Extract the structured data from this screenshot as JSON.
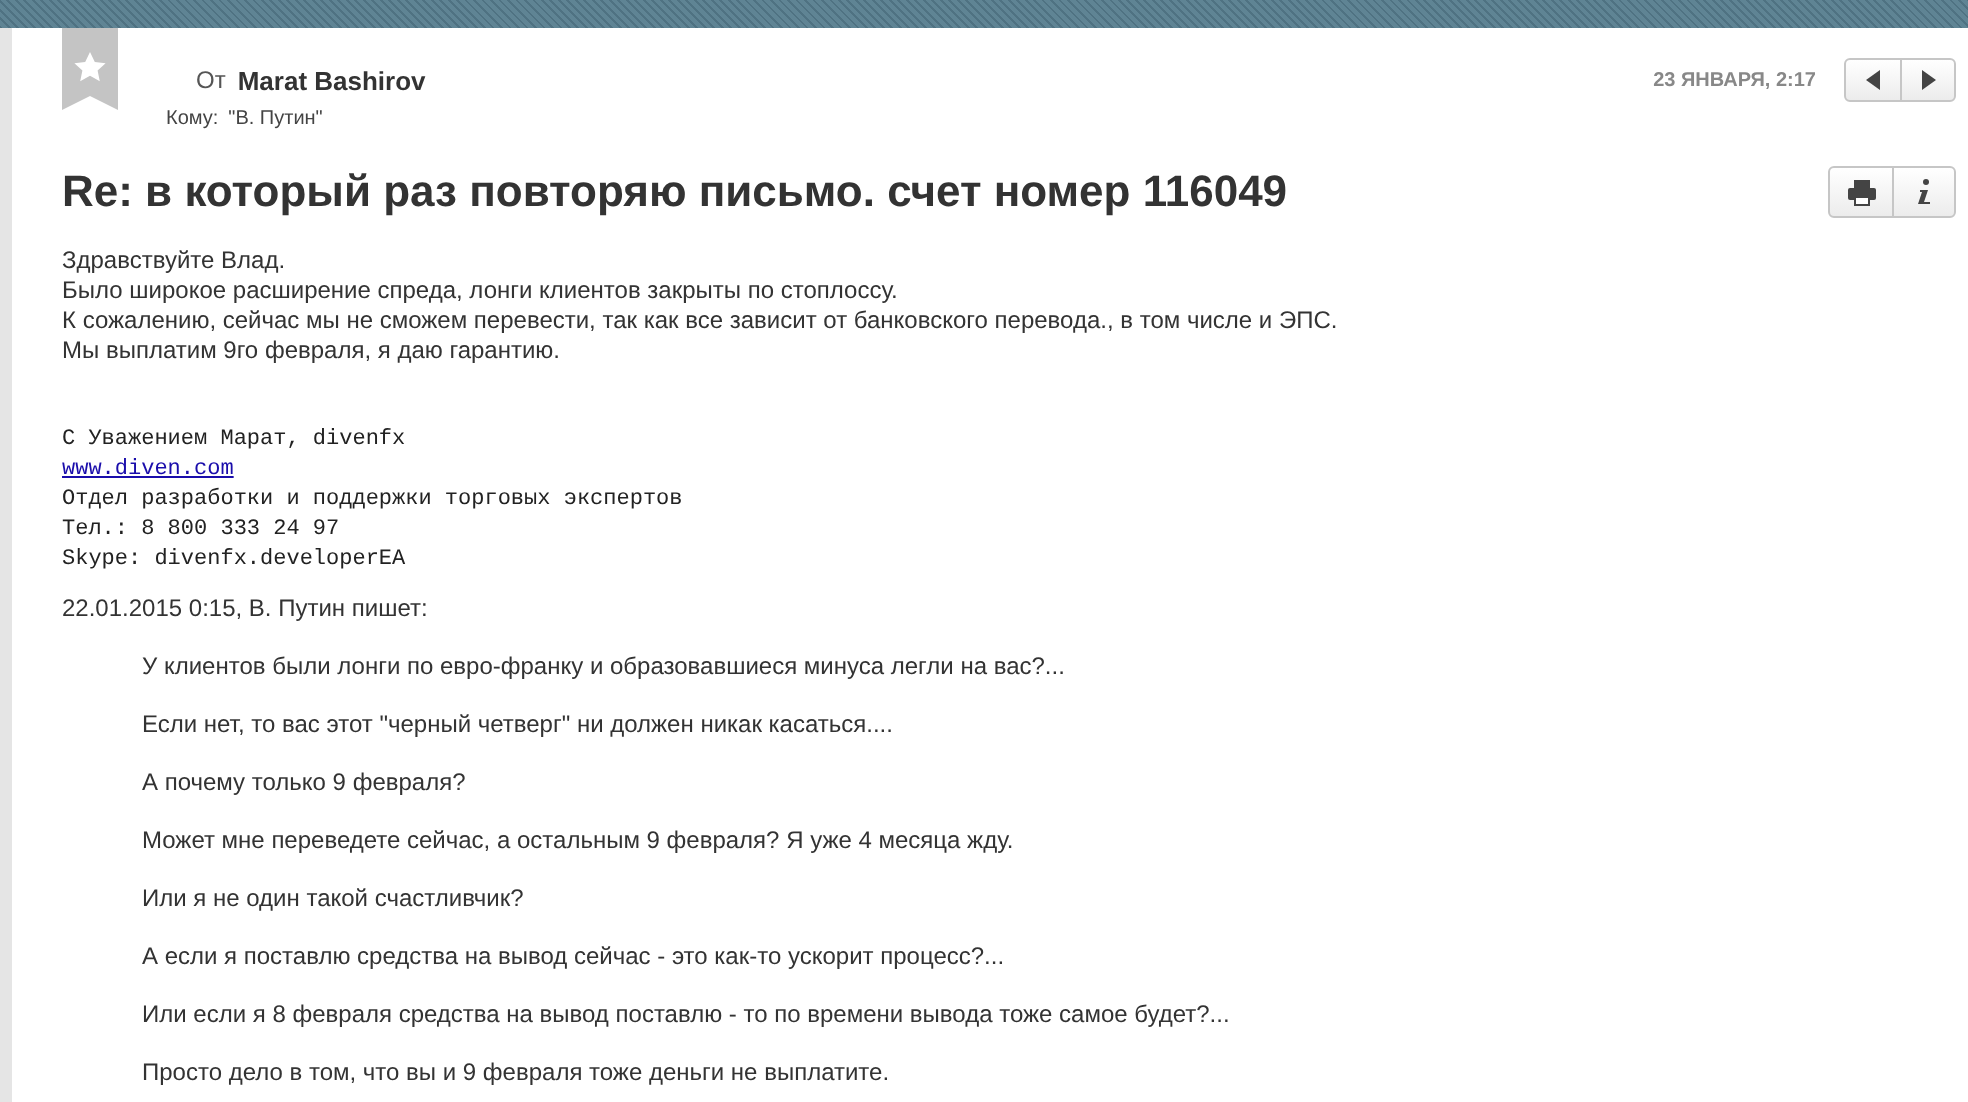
{
  "header": {
    "from_label": "От",
    "from_name": "Marat Bashirov",
    "to_label": "Кому:",
    "to_value": "\"В. Путин\"",
    "date": "23 ЯНВАРЯ, 2:17"
  },
  "subject": "Re: в который раз повторяю письмо. счет номер 116049",
  "body": [
    "Здравствуйте Влад.",
    "Было широкое расширение спреда, лонги клиентов закрыты по стоплоссу.",
    "К сожалению, сейчас мы не сможем перевести, так как все зависит от банковского перевода., в том числе и ЭПС.",
    "Мы выплатим 9го февраля, я даю гарантию."
  ],
  "signature": [
    {
      "kind": "text",
      "text": "С Уважением Марат, divenfx"
    },
    {
      "kind": "link",
      "text": "www.diven.com"
    },
    {
      "kind": "text",
      "text": "Отдел разработки и поддержки торговых экспертов"
    },
    {
      "kind": "text",
      "text": "Тел.: 8 800 333 24 97"
    },
    {
      "kind": "text",
      "text": "Skype: divenfx.developerEA"
    }
  ],
  "quote_header": "22.01.2015 0:15, В. Путин пишет:",
  "quote": [
    "У клиентов были лонги по евро-франку и образовавшиеся минуса легли на вас?...",
    "Если нет, то вас этот \"черный четверг\" ни должен никак касаться....",
    "А почему только 9 февраля?",
    "Может мне переведете сейчас, а остальным 9 февраля? Я уже 4 месяца жду.",
    "Или я не один такой счастливчик?",
    "А если я поставлю средства на вывод сейчас - это как-то ускорит процесс?...",
    "Или если я 8 февраля средства на вывод поставлю - то по времени вывода тоже самое будет?...",
    "Просто дело в том, что вы и 9 февраля тоже деньги не выплатите."
  ]
}
